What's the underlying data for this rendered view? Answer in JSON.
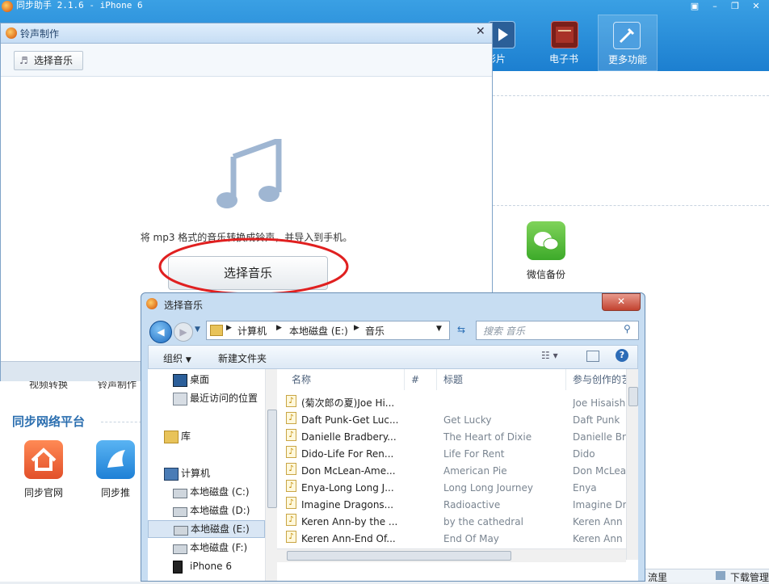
{
  "app": {
    "title": "同步助手 2.1.6 - iPhone 6",
    "window_buttons": [
      "▣",
      "–",
      "❐",
      "✕"
    ],
    "nav": [
      {
        "label": "影片",
        "icon": "video-icon"
      },
      {
        "label": "电子书",
        "icon": "ebook-icon"
      },
      {
        "label": "更多功能",
        "icon": "tools-icon"
      }
    ],
    "wechat_backup_label": "微信备份",
    "partial_labels": [
      "视频转换",
      "铃声制作"
    ],
    "platform_heading": "同步网络平台",
    "platform_items": [
      {
        "label": "同步官网",
        "icon": "home-icon"
      },
      {
        "label": "同步推",
        "icon": "tongbutui-icon"
      }
    ],
    "bottom_partial": [
      "流里",
      "下载管理"
    ]
  },
  "ringtone": {
    "title": "铃声制作",
    "choose_top_label": "选择音乐",
    "hint": "将 mp3 格式的音乐转换成铃声，并导入到手机。",
    "choose_button": "选择音乐"
  },
  "file_dialog": {
    "title": "选择音乐",
    "breadcrumb": [
      "计算机",
      "本地磁盘 (E:)",
      "音乐"
    ],
    "search_placeholder": "搜索 音乐",
    "organize_label": "组织",
    "new_folder_label": "新建文件夹",
    "tree": [
      {
        "label": "桌面",
        "icon": "desktop-icon",
        "level": 1
      },
      {
        "label": "最近访问的位置",
        "icon": "recent-icon",
        "level": 1
      },
      {
        "label": "库",
        "icon": "library-icon",
        "level": 0
      },
      {
        "label": "计算机",
        "icon": "computer-icon",
        "level": 0
      },
      {
        "label": "本地磁盘 (C:)",
        "icon": "drive-icon",
        "level": 1
      },
      {
        "label": "本地磁盘 (D:)",
        "icon": "drive-icon",
        "level": 1
      },
      {
        "label": "本地磁盘 (E:)",
        "icon": "drive-icon",
        "level": 1,
        "selected": true
      },
      {
        "label": "本地磁盘 (F:)",
        "icon": "drive-icon",
        "level": 1
      },
      {
        "label": "iPhone 6",
        "icon": "phone-icon",
        "level": 1
      }
    ],
    "columns": [
      "名称",
      "#",
      "标题",
      "参与创作的艺"
    ],
    "files": [
      {
        "name": "(菊次郎の夏)Joe Hi...",
        "title": "",
        "artist": "Joe Hisaishi"
      },
      {
        "name": "Daft Punk-Get Luc...",
        "title": "Get Lucky",
        "artist": "Daft Punk"
      },
      {
        "name": "Danielle Bradbery...",
        "title": "The Heart of Dixie",
        "artist": "Danielle Bra"
      },
      {
        "name": "Dido-Life For Ren...",
        "title": "Life For Rent",
        "artist": "Dido"
      },
      {
        "name": "Don McLean-Ame...",
        "title": "American Pie",
        "artist": "Don McLea"
      },
      {
        "name": "Enya-Long Long J...",
        "title": "Long Long Journey",
        "artist": "Enya"
      },
      {
        "name": "Imagine Dragons...",
        "title": "Radioactive",
        "artist": "Imagine Dr"
      },
      {
        "name": "Keren Ann-by the ...",
        "title": "by the cathedral",
        "artist": "Keren Ann"
      },
      {
        "name": "Keren Ann-End Of...",
        "title": "End Of May",
        "artist": "Keren Ann"
      }
    ]
  },
  "colors": {
    "title_blue": "#1c7fd0",
    "annotation_red": "#e02020"
  }
}
